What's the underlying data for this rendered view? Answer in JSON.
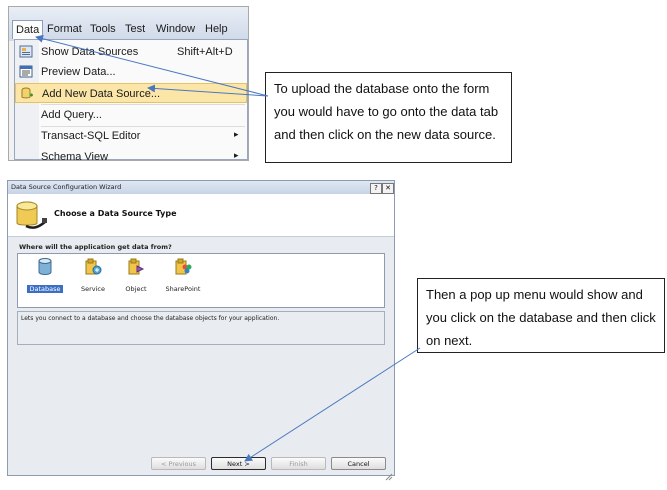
{
  "menubar": {
    "items": [
      "Data",
      "Format",
      "Tools",
      "Test",
      "Window",
      "Help"
    ]
  },
  "data_menu": {
    "items": [
      {
        "label": "Show Data Sources",
        "shortcut": "Shift+Alt+D",
        "icon": "data-sources-icon"
      },
      {
        "label": "Preview Data...",
        "icon": "preview-data-icon"
      },
      {
        "label": "Add New Data Source...",
        "icon": "add-data-source-icon",
        "highlighted": true
      },
      {
        "label": "Add Query..."
      },
      {
        "label": "Transact-SQL Editor",
        "submenu": true
      },
      {
        "label": "Schema View",
        "submenu": true
      }
    ],
    "submenu_arrow": "▸"
  },
  "callout1": {
    "text": "To upload the database onto the form you would have to go onto the data tab and then click on the new data source."
  },
  "callout2": {
    "text": "Then a pop up menu would show and you click on the database and then click on next."
  },
  "wizard": {
    "title": "Data Source Configuration Wizard",
    "help_button": "?",
    "close_button": "✕",
    "header_title": "Choose a Data Source Type",
    "question": "Where will the application get data from?",
    "choices": [
      {
        "label": "Database",
        "selected": true
      },
      {
        "label": "Service"
      },
      {
        "label": "Object"
      },
      {
        "label": "SharePoint"
      }
    ],
    "description": "Lets you connect to a database and choose the database objects for your application.",
    "buttons": {
      "previous": "< Previous",
      "next": "Next >",
      "finish": "Finish",
      "cancel": "Cancel"
    }
  },
  "colors": {
    "highlight": "#fbe6a8",
    "selection": "#3a6fc4",
    "arrow": "#4a78c0"
  }
}
